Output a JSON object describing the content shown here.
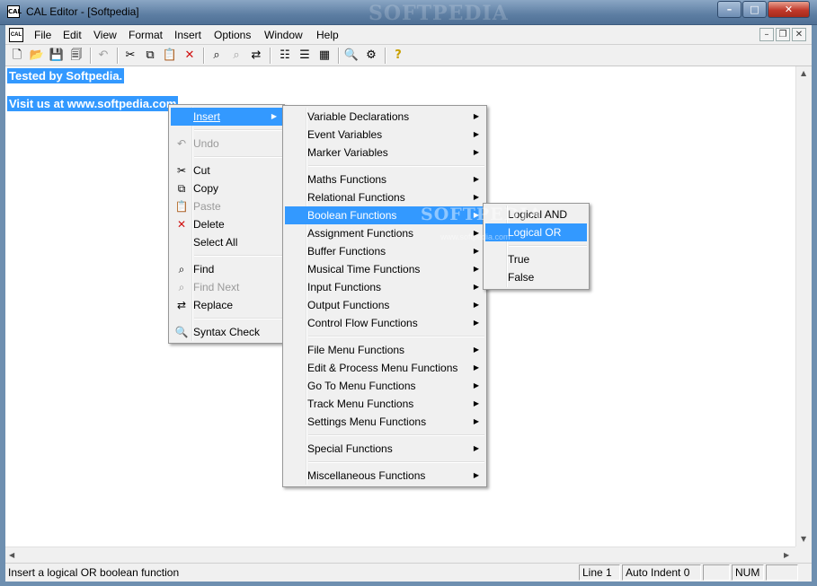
{
  "window": {
    "title": "CAL Editor - [Softpedia]",
    "app_icon_text": "CAL",
    "watermark": "SOFTPEDIA",
    "min": "–",
    "max": "□",
    "close": "✕"
  },
  "menubar": {
    "items": [
      "File",
      "Edit",
      "View",
      "Format",
      "Insert",
      "Options",
      "Window",
      "Help"
    ],
    "mdi_min": "–",
    "mdi_restore": "❐",
    "mdi_close": "✕"
  },
  "toolbar": {
    "icons": [
      "new-file-icon",
      "open-folder-icon",
      "save-icon",
      "save-all-icon",
      "undo-icon",
      "cut-icon",
      "copy-icon",
      "paste-icon",
      "delete-icon",
      "find-icon",
      "find-next-icon",
      "replace-icon",
      "indent-icon",
      "outdent-icon",
      "format-icon",
      "search-icon",
      "syntax-check-icon",
      "help-icon"
    ]
  },
  "editor": {
    "lines": [
      "Tested by Softpedia.",
      "Visit us at www.softpedia.com"
    ]
  },
  "context_menu": {
    "insert": "Insert",
    "undo": "Undo",
    "cut": "Cut",
    "copy": "Copy",
    "paste": "Paste",
    "delete": "Delete",
    "select_all": "Select All",
    "find": "Find",
    "find_next": "Find Next",
    "replace": "Replace",
    "syntax_check": "Syntax Check"
  },
  "insert_menu": {
    "items": [
      "Variable Declarations",
      "Event Variables",
      "Marker Variables",
      "Maths Functions",
      "Relational Functions",
      "Boolean Functions",
      "Assignment Functions",
      "Buffer Functions",
      "Musical Time Functions",
      "Input Functions",
      "Output Functions",
      "Control Flow Functions",
      "File Menu Functions",
      "Edit & Process Menu Functions",
      "Go To Menu Functions",
      "Track Menu Functions",
      "Settings Menu Functions",
      "Special Functions",
      "Miscellaneous Functions"
    ]
  },
  "boolean_menu": {
    "items": [
      "Logical AND",
      "Logical OR",
      "True",
      "False"
    ],
    "watermark": "SOFTPEDIA",
    "watermark_url": "www.softpedia.com"
  },
  "statusbar": {
    "text": "Insert a logical OR boolean function",
    "line": "Line 1",
    "auto_indent": "Auto Indent 0",
    "empty": "",
    "num": "NUM"
  },
  "colors": {
    "selection": "#3399ff",
    "titlebar": "#5d7ea3",
    "close": "#c0392b"
  }
}
